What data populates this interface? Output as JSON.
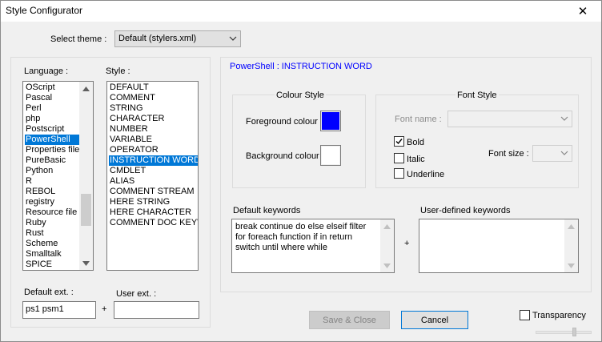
{
  "window": {
    "title": "Style Configurator",
    "close_glyph": "✕"
  },
  "theme": {
    "label": "Select theme :",
    "value": "Default (stylers.xml)"
  },
  "language": {
    "label": "Language :",
    "items": [
      "OScript",
      "Pascal",
      "Perl",
      "php",
      "Postscript",
      "PowerShell",
      "Properties file",
      "PureBasic",
      "Python",
      "R",
      "REBOL",
      "registry",
      "Resource file",
      "Ruby",
      "Rust",
      "Scheme",
      "Smalltalk",
      "SPICE"
    ],
    "selected": "PowerShell"
  },
  "style": {
    "label": "Style :",
    "items": [
      "DEFAULT",
      "COMMENT",
      "STRING",
      "CHARACTER",
      "NUMBER",
      "VARIABLE",
      "OPERATOR",
      "INSTRUCTION WORD",
      "CMDLET",
      "ALIAS",
      "COMMENT STREAM",
      "HERE STRING",
      "HERE CHARACTER",
      "COMMENT DOC KEYWORD"
    ],
    "selected": "INSTRUCTION WORD"
  },
  "ext": {
    "default_label": "Default ext. :",
    "default_value": "ps1 psm1",
    "plus": "+",
    "user_label": "User ext. :",
    "user_value": ""
  },
  "detail": {
    "heading": "PowerShell : INSTRUCTION WORD",
    "heading_color": "#0000ff"
  },
  "colour_style": {
    "title": "Colour Style",
    "fg_label": "Foreground colour",
    "fg_color": "#0000ff",
    "bg_label": "Background colour",
    "bg_color": "#ffffff"
  },
  "font_style": {
    "title": "Font Style",
    "font_name_label": "Font name :",
    "font_name_value": "",
    "font_size_label": "Font size :",
    "font_size_value": "",
    "bold_label": "Bold",
    "bold_checked": true,
    "italic_label": "Italic",
    "italic_checked": false,
    "underline_label": "Underline",
    "underline_checked": false
  },
  "keywords": {
    "default_label": "Default keywords",
    "default_value": "break continue do else elseif filter for foreach function if in return switch until where while",
    "plus": "+",
    "user_label": "User-defined keywords",
    "user_value": ""
  },
  "footer": {
    "save_close": "Save & Close",
    "cancel": "Cancel",
    "transparency_label": "Transparency",
    "transparency_checked": false
  }
}
